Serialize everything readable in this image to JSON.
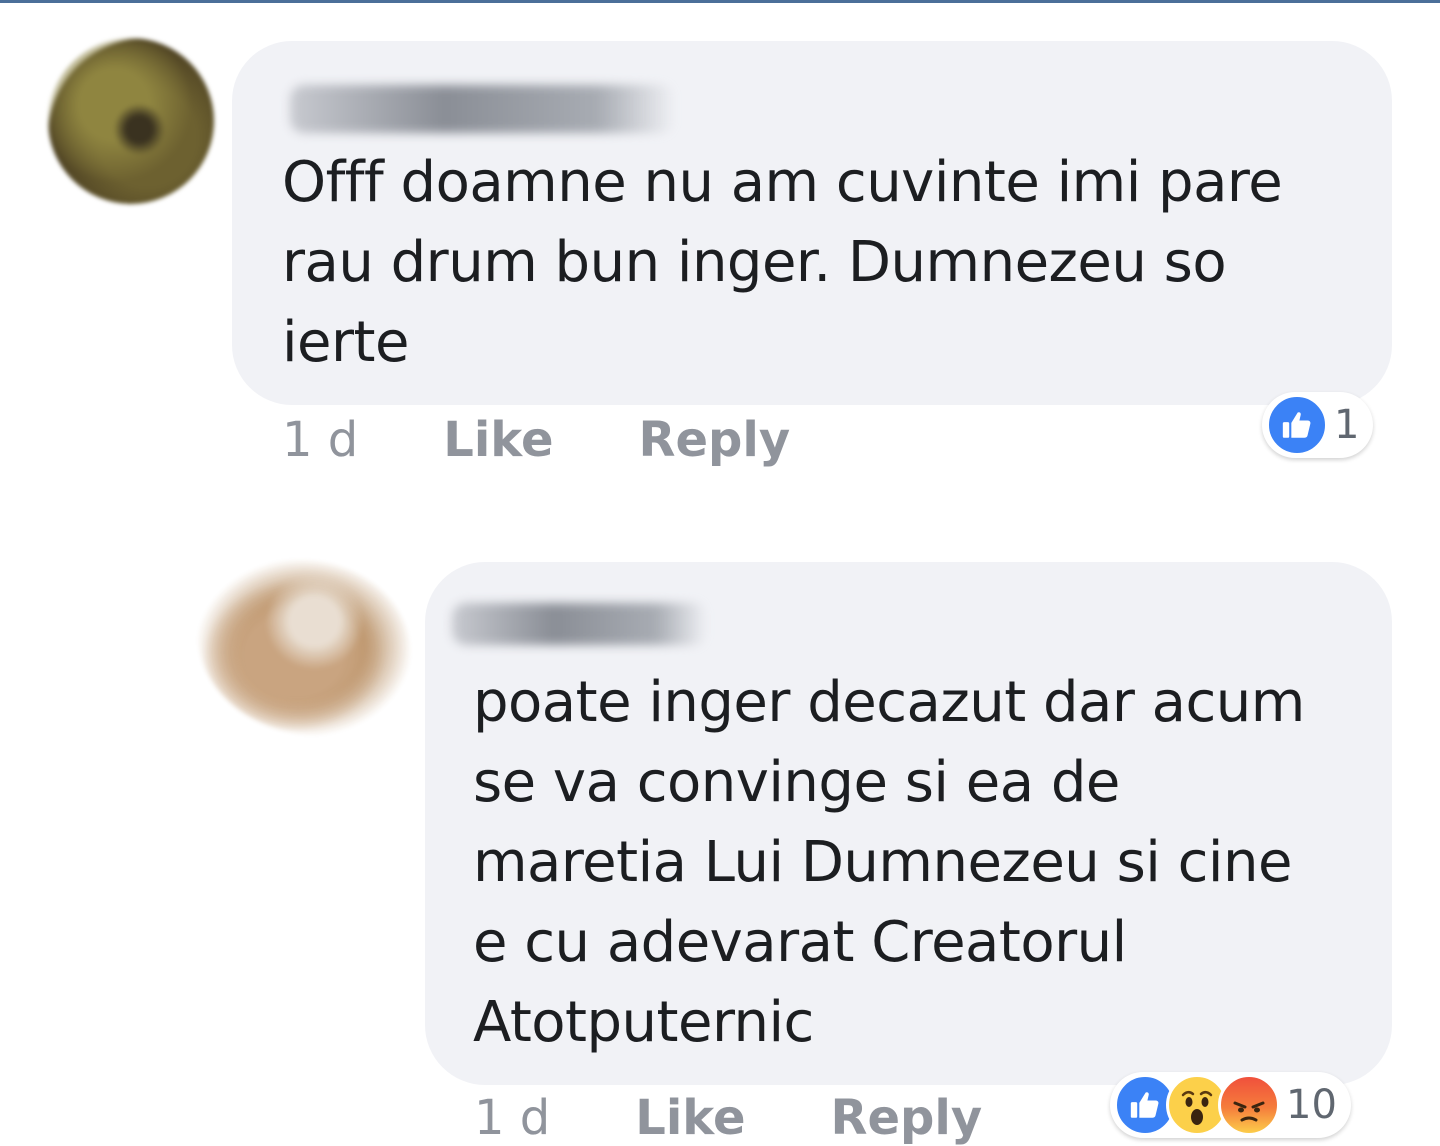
{
  "comments": [
    {
      "author": "",
      "text": "Offf doamne nu am cuvinte imi pare\nrau drum bun inger. Dumnezeu so\nierte",
      "time": "1 d",
      "like_label": "Like",
      "reply_label": "Reply",
      "reactions": {
        "icons": [
          "like-icon"
        ],
        "count": "1"
      }
    },
    {
      "author": "",
      "text": "poate inger decazut dar acum\nse va convinge si ea de\nmaretia Lui Dumnezeu si cine\ne cu adevarat Creatorul\nAtotputernic",
      "time": "1 d",
      "like_label": "Like",
      "reply_label": "Reply",
      "reactions": {
        "icons": [
          "like-icon",
          "wow-icon",
          "angry-icon"
        ],
        "count": "10"
      }
    }
  ],
  "colors": {
    "bubble": "#f1f2f6",
    "text": "#1c1e21",
    "meta": "#90949c",
    "like_blue": "#3b82f6",
    "wow_yellow": "#fcd04a",
    "angry_red": "#f0503c"
  }
}
